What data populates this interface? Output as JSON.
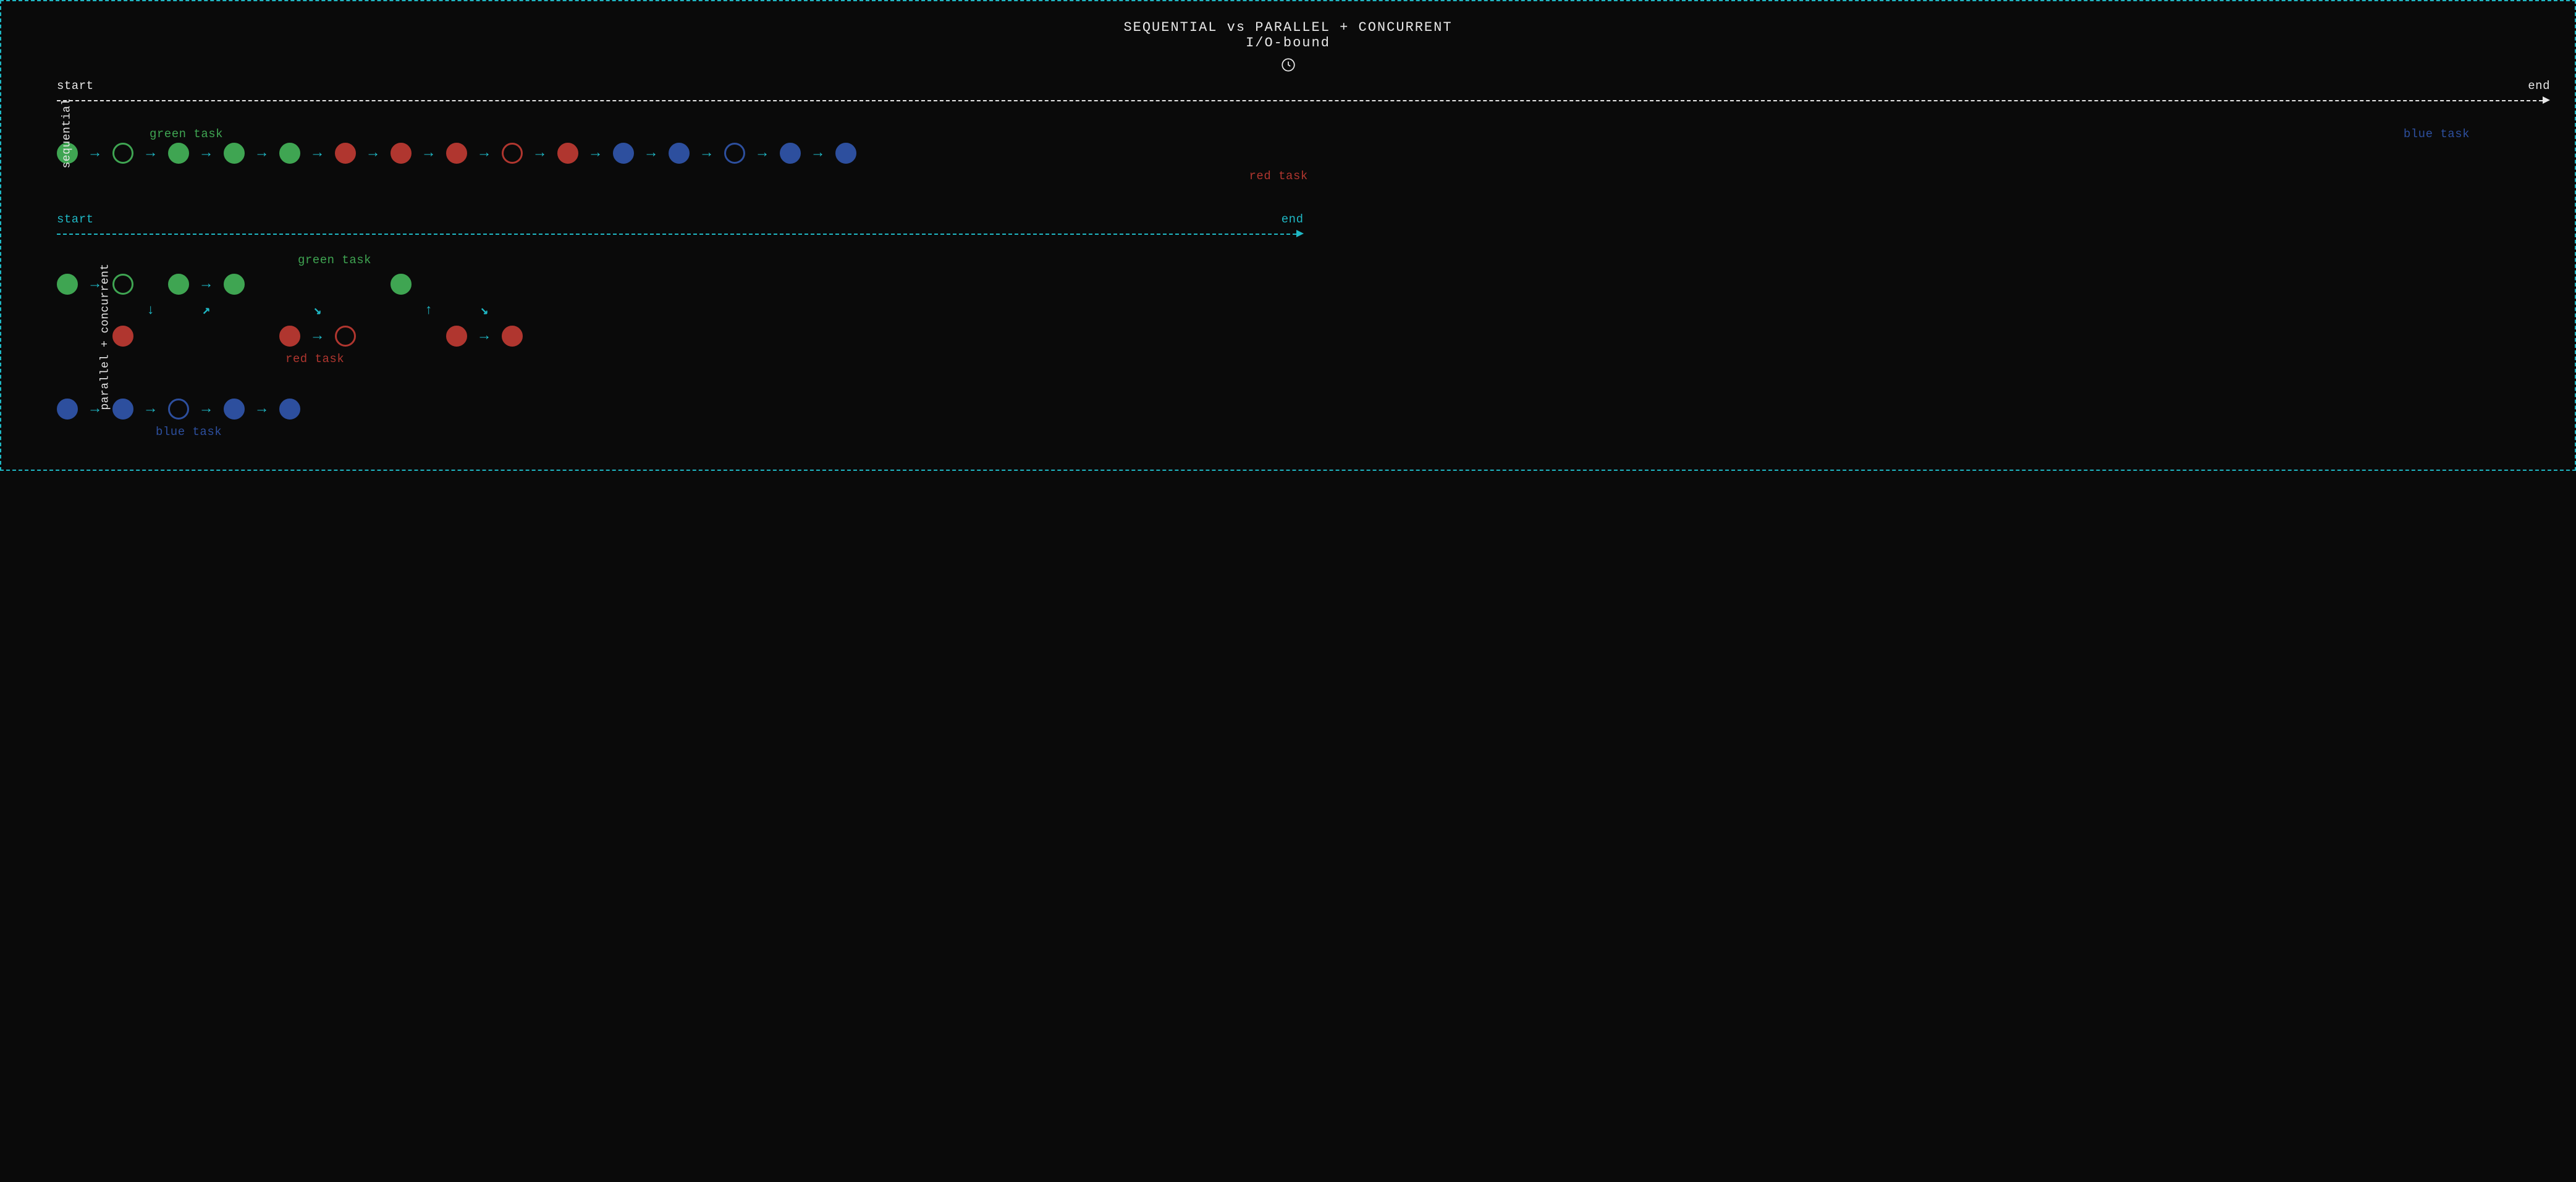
{
  "title": "SEQUENTIAL vs PARALLEL + CONCURRENT",
  "subtitle": "I/O-bound",
  "timeline": {
    "start": "start",
    "end": "end"
  },
  "labels": {
    "sequential": "sequential",
    "parallel_concurrent": "parallel + concurrent",
    "green_task": "green task",
    "red_task": "red task",
    "blue_task": "blue task"
  },
  "colors": {
    "green": "#3fa552",
    "red": "#b0362f",
    "blue": "#2d4f9e",
    "cyan": "#1fb8c5",
    "white": "#e8e8e8",
    "bg": "#0a0a0a"
  },
  "sequential": {
    "steps": [
      {
        "color": "green",
        "hollow": false
      },
      {
        "color": "green",
        "hollow": true
      },
      {
        "color": "green",
        "hollow": false
      },
      {
        "color": "green",
        "hollow": false
      },
      {
        "color": "green",
        "hollow": false
      },
      {
        "color": "red",
        "hollow": false
      },
      {
        "color": "red",
        "hollow": false
      },
      {
        "color": "red",
        "hollow": false
      },
      {
        "color": "red",
        "hollow": true
      },
      {
        "color": "red",
        "hollow": false
      },
      {
        "color": "blue",
        "hollow": false
      },
      {
        "color": "blue",
        "hollow": false
      },
      {
        "color": "blue",
        "hollow": true
      },
      {
        "color": "blue",
        "hollow": false
      },
      {
        "color": "blue",
        "hollow": false
      }
    ]
  },
  "parallel": {
    "rows": {
      "green": [
        {
          "type": "dot",
          "color": "green",
          "hollow": false
        },
        {
          "type": "arrow",
          "dir": "right"
        },
        {
          "type": "dot",
          "color": "green",
          "hollow": true
        },
        {
          "type": "gap"
        },
        {
          "type": "dot",
          "color": "green",
          "hollow": false
        },
        {
          "type": "arrow",
          "dir": "right"
        },
        {
          "type": "dot",
          "color": "green",
          "hollow": false
        },
        {
          "type": "gap"
        },
        {
          "type": "empty"
        },
        {
          "type": "gap"
        },
        {
          "type": "empty"
        },
        {
          "type": "gap"
        },
        {
          "type": "dot",
          "color": "green",
          "hollow": false
        }
      ],
      "switch": [
        {
          "type": "empty"
        },
        {
          "type": "gap"
        },
        {
          "type": "empty"
        },
        {
          "type": "arrow",
          "dir": "down"
        },
        {
          "type": "empty"
        },
        {
          "type": "arrow",
          "dir": "upright"
        },
        {
          "type": "empty"
        },
        {
          "type": "gap"
        },
        {
          "type": "empty"
        },
        {
          "type": "arrow",
          "dir": "downright"
        },
        {
          "type": "empty"
        },
        {
          "type": "gap"
        },
        {
          "type": "empty"
        },
        {
          "type": "arrow",
          "dir": "up"
        },
        {
          "type": "empty"
        },
        {
          "type": "arrow",
          "dir": "downright"
        }
      ],
      "red": [
        {
          "type": "empty"
        },
        {
          "type": "gap"
        },
        {
          "type": "dot",
          "color": "red",
          "hollow": false
        },
        {
          "type": "gap"
        },
        {
          "type": "empty"
        },
        {
          "type": "gap"
        },
        {
          "type": "empty"
        },
        {
          "type": "gap"
        },
        {
          "type": "dot",
          "color": "red",
          "hollow": false
        },
        {
          "type": "arrow",
          "dir": "right"
        },
        {
          "type": "dot",
          "color": "red",
          "hollow": true
        },
        {
          "type": "gap"
        },
        {
          "type": "empty"
        },
        {
          "type": "gap"
        },
        {
          "type": "dot",
          "color": "red",
          "hollow": false
        },
        {
          "type": "arrow",
          "dir": "right"
        },
        {
          "type": "dot",
          "color": "red",
          "hollow": false
        }
      ],
      "blue": [
        {
          "type": "dot",
          "color": "blue",
          "hollow": false
        },
        {
          "type": "arrow",
          "dir": "right"
        },
        {
          "type": "dot",
          "color": "blue",
          "hollow": false
        },
        {
          "type": "arrow",
          "dir": "right"
        },
        {
          "type": "dot",
          "color": "blue",
          "hollow": true
        },
        {
          "type": "arrow",
          "dir": "right"
        },
        {
          "type": "dot",
          "color": "blue",
          "hollow": false
        },
        {
          "type": "arrow",
          "dir": "right"
        },
        {
          "type": "dot",
          "color": "blue",
          "hollow": false
        }
      ]
    }
  },
  "arrows": {
    "right": "→",
    "down": "↓",
    "up": "↑",
    "upright": "↗",
    "downright": "↘"
  }
}
